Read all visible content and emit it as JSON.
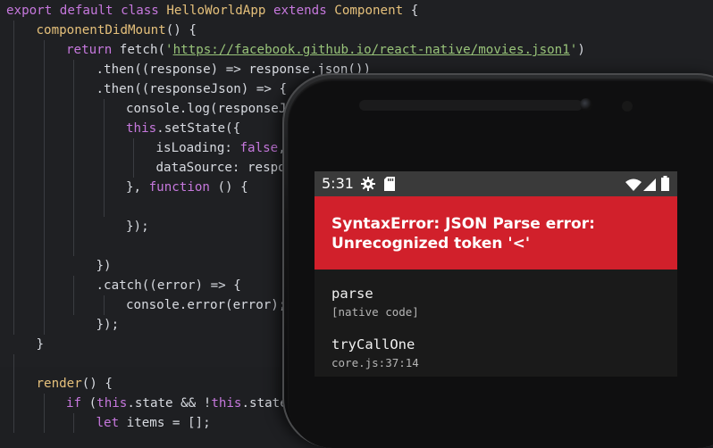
{
  "editor": {
    "lines": [
      {
        "indent": 0,
        "tokens": [
          [
            "kw",
            "export default class "
          ],
          [
            "fn",
            "HelloWorldApp"
          ],
          [
            "kw",
            " extends "
          ],
          [
            "fn",
            "Component"
          ],
          [
            "plain",
            " {"
          ]
        ]
      },
      {
        "indent": 1,
        "tokens": [
          [
            "fn",
            "componentDidMount"
          ],
          [
            "plain",
            "() {"
          ]
        ]
      },
      {
        "indent": 2,
        "tokens": [
          [
            "kw",
            "return "
          ],
          [
            "plain",
            "fetch("
          ],
          [
            "str",
            "'"
          ],
          [
            "url",
            "https://facebook.github.io/react-native/movies.json1"
          ],
          [
            "str",
            "'"
          ],
          [
            "plain",
            ")"
          ]
        ]
      },
      {
        "indent": 3,
        "tokens": [
          [
            "plain",
            ".then((response) => response.json())"
          ]
        ]
      },
      {
        "indent": 3,
        "tokens": [
          [
            "plain",
            ".then((responseJson) => {"
          ]
        ]
      },
      {
        "indent": 4,
        "tokens": [
          [
            "plain",
            "console.log(responseJson"
          ]
        ]
      },
      {
        "indent": 4,
        "tokens": [
          [
            "kw",
            "this"
          ],
          [
            "plain",
            ".setState({"
          ]
        ]
      },
      {
        "indent": 5,
        "tokens": [
          [
            "plain",
            "isLoading: "
          ],
          [
            "kw",
            "false"
          ],
          [
            "plain",
            ","
          ]
        ]
      },
      {
        "indent": 5,
        "tokens": [
          [
            "plain",
            "dataSource: respon"
          ]
        ]
      },
      {
        "indent": 4,
        "tokens": [
          [
            "plain",
            "}, "
          ],
          [
            "kw",
            "function"
          ],
          [
            "plain",
            " () {"
          ]
        ]
      },
      {
        "indent": 4,
        "tokens": [
          [
            "plain",
            ""
          ]
        ]
      },
      {
        "indent": 4,
        "tokens": [
          [
            "plain",
            "});"
          ]
        ]
      },
      {
        "indent": 3,
        "tokens": [
          [
            "plain",
            ""
          ]
        ]
      },
      {
        "indent": 3,
        "tokens": [
          [
            "plain",
            "})"
          ]
        ]
      },
      {
        "indent": 3,
        "tokens": [
          [
            "plain",
            ".catch((error) => {"
          ]
        ]
      },
      {
        "indent": 4,
        "tokens": [
          [
            "plain",
            "console.error(error);"
          ]
        ]
      },
      {
        "indent": 3,
        "tokens": [
          [
            "plain",
            "});"
          ]
        ]
      },
      {
        "indent": 1,
        "tokens": [
          [
            "plain",
            "}"
          ]
        ]
      },
      {
        "indent": 1,
        "tokens": [
          [
            "plain",
            ""
          ]
        ]
      },
      {
        "indent": 1,
        "tokens": [
          [
            "fn",
            "render"
          ],
          [
            "plain",
            "() {"
          ]
        ]
      },
      {
        "indent": 2,
        "tokens": [
          [
            "kw",
            "if "
          ],
          [
            "plain",
            "("
          ],
          [
            "kw",
            "this"
          ],
          [
            "plain",
            ".state && !"
          ],
          [
            "kw",
            "this"
          ],
          [
            "plain",
            ".state"
          ]
        ]
      },
      {
        "indent": 3,
        "tokens": [
          [
            "kw",
            "let "
          ],
          [
            "plain",
            "items = [];"
          ]
        ]
      }
    ]
  },
  "phone": {
    "status_bar": {
      "time": "5:31"
    },
    "error": {
      "title": "SyntaxError: JSON Parse error: Unrecognized token '<'"
    },
    "stack": [
      {
        "fn": "parse",
        "loc": "[native code]"
      },
      {
        "fn": "tryCallOne",
        "loc": "core.js:37:14"
      }
    ]
  },
  "colors": {
    "error_red": "#d1202b",
    "keyword": "#c678dd",
    "type": "#e5c07b",
    "string": "#98c379"
  },
  "icons": [
    "gear-icon",
    "sdcard-icon",
    "wifi-icon",
    "signal-icon",
    "battery-icon"
  ]
}
